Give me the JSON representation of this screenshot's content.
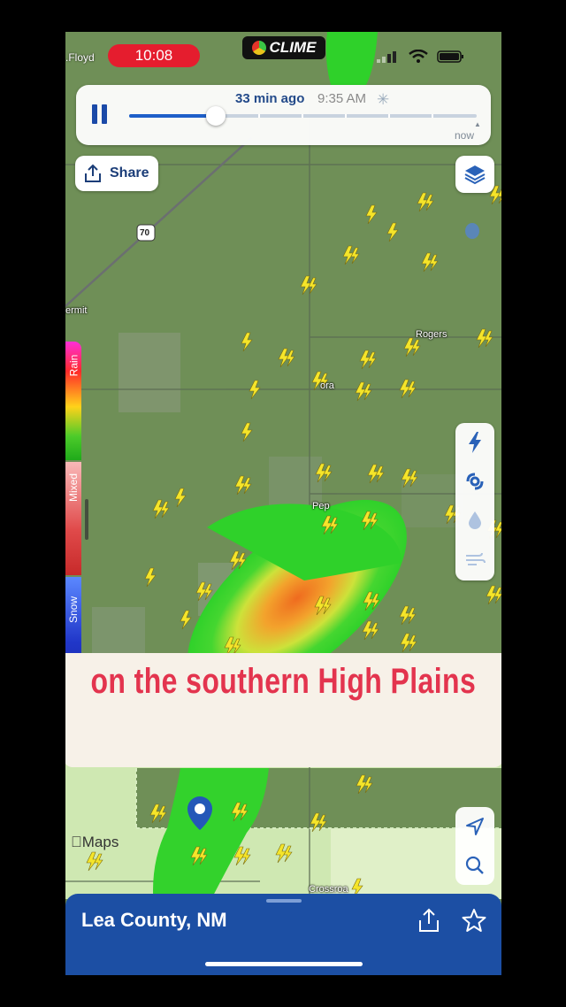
{
  "status_bar": {
    "origin_label": ".Floyd",
    "time": "10:08",
    "app_logo_text": "CLIME"
  },
  "timeline": {
    "play_state": "pause",
    "time_ago": "33 min ago",
    "timestamp": "9:35 AM",
    "end_label": "now",
    "progress": 0.25
  },
  "toolbar": {
    "share_label": "Share",
    "layers_icon": "layers-icon"
  },
  "legend": {
    "rain_label": "Rain",
    "mixed_label": "Mixed",
    "snow_label": "Snow"
  },
  "map": {
    "place_labels": {
      "hermit": "ermit",
      "rogers": "Rogers",
      "dora": "ora",
      "pep": "Pep",
      "crossroads": "Crossroa",
      "route": "70"
    },
    "credit": "Maps"
  },
  "layer_controls": [
    "lightning-icon",
    "hurricane-icon",
    "precipitation-drop-icon",
    "wind-icon"
  ],
  "caption": {
    "text": "on the southern High Plains"
  },
  "location_sheet": {
    "title": "Lea County, NM"
  },
  "colors": {
    "accent": "#1c4fa4",
    "caption_text": "#e3344e",
    "clock_pill": "#e51d2e",
    "lightning": "#f5e52a"
  }
}
